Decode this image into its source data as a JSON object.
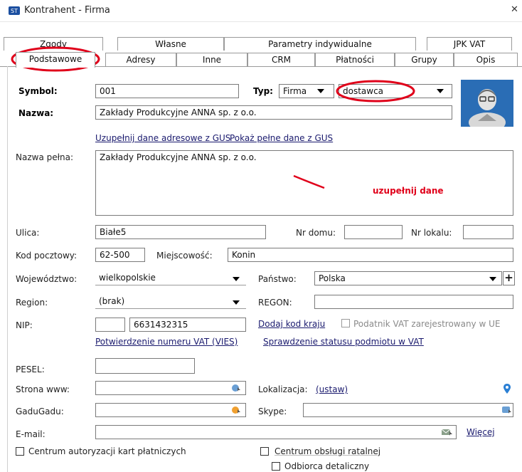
{
  "window": {
    "title": "Kontrahent - Firma",
    "close_glyph": "✕"
  },
  "tabs_row1": [
    "Zgody",
    "Własne",
    "Parametry indywidualne",
    "JPK VAT"
  ],
  "tabs_row2": [
    "Podstawowe",
    "Adresy",
    "Inne",
    "CRM",
    "Płatności",
    "Grupy",
    "Opis"
  ],
  "form": {
    "symbol_label": "Symbol:",
    "symbol_value": "001",
    "typ_label": "Typ:",
    "typ_value": "Firma",
    "typ2_value": "dostawca",
    "nazwa_label": "Nazwa:",
    "nazwa_value": "Zakłady Produkcyjne ANNA sp. z o.o.",
    "gus_link1": "Uzupełnij dane adresowe z GUS",
    "gus_link2": "Pokaż pełne dane z GUS",
    "nazwa_pelna_label": "Nazwa pełna:",
    "nazwa_pelna_value": "Zakłady Produkcyjne ANNA sp. z o.o.",
    "annotation": "uzupełnij dane",
    "ulica_label": "Ulica:",
    "ulica_value": "Białe5",
    "nr_domu_label": "Nr domu:",
    "nr_domu_value": "",
    "nr_lokalu_label": "Nr lokalu:",
    "nr_lokalu_value": "",
    "kod_label": "Kod pocztowy:",
    "kod_value": "62-500",
    "miejscowosc_label": "Miejscowość:",
    "miejscowosc_value": "Konin",
    "woj_label": "Województwo:",
    "woj_value": "wielkopolskie",
    "panstwo_label": "Państwo:",
    "panstwo_value": "Polska",
    "region_label": "Region:",
    "region_value": "(brak)",
    "regon_label": "REGON:",
    "regon_value": "",
    "nip_label": "NIP:",
    "nip_prefix": "",
    "nip_value": "6631432315",
    "dodaj_kod_link": "Dodaj kod kraju",
    "vat_ue_label": "Podatnik VAT zarejestrowany w UE",
    "vies_link": "Potwierdzenie numeru VAT (VIES)",
    "status_vat_link": "Sprawdzenie statusu podmiotu w VAT",
    "pesel_label": "PESEL:",
    "pesel_value": "",
    "www_label": "Strona www:",
    "www_value": "",
    "lokalizacja_label": "Lokalizacja:",
    "lokalizacja_link": "(ustaw)",
    "gadu_label": "GaduGadu:",
    "gadu_value": "",
    "skype_label": "Skype:",
    "skype_value": "",
    "email_label": "E-mail:",
    "email_value": "",
    "wiecej_link": "Więcej",
    "centrum_kart_label": "Centrum autoryzacji kart płatniczych",
    "centrum_rat_label": "Centrum obsługi ratalnej",
    "odbiorca_label": "Odbiorca detaliczny"
  },
  "colors": {
    "annotation": "#e0001a",
    "accent": "#1b4fa0"
  }
}
